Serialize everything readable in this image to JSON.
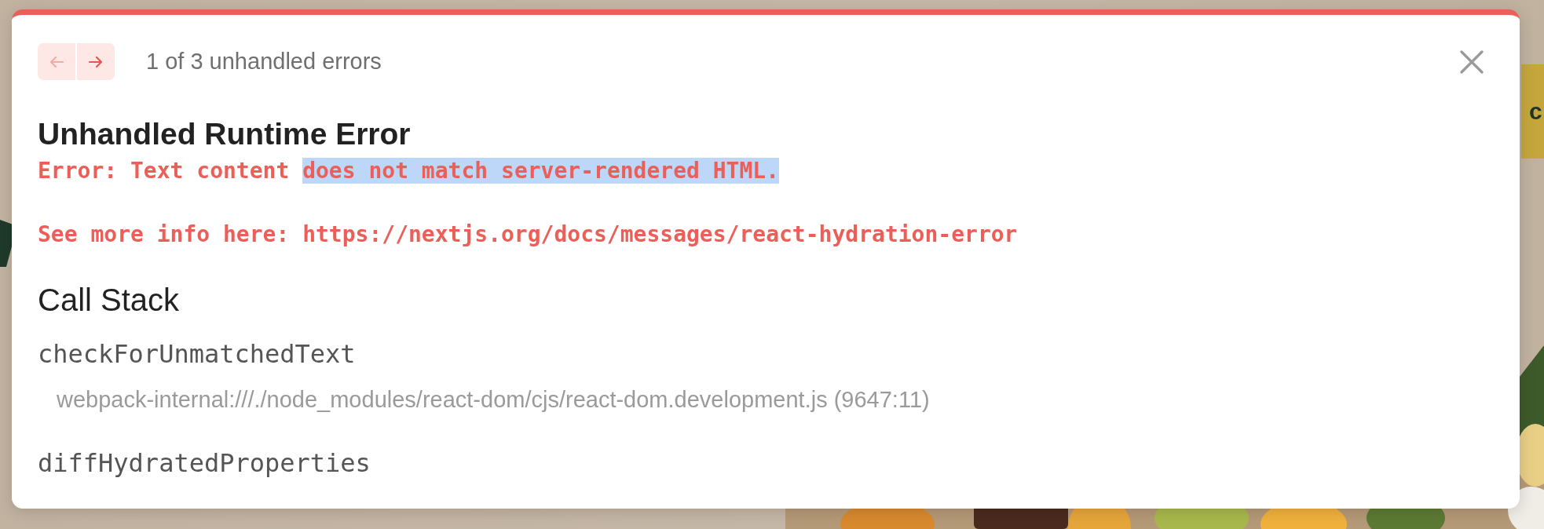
{
  "background": {
    "banner_text": "c",
    "kind": "picture"
  },
  "dialog": {
    "navigation": [
      {
        "kind": "previous",
        "disabled": true
      },
      {
        "kind": "next",
        "disabled": false
      }
    ],
    "counter": "1 of 3 unhandled errors",
    "title": "Unhandled Runtime Error",
    "error_message": {
      "text": "Error: Text content ",
      "selected_text": "does not match server-rendered HTML."
    },
    "info_line": "See more info here: https://nextjs.org/docs/messages/react-hydration-error",
    "call_stack": {
      "heading": "Call Stack",
      "frames": [
        {
          "function": "checkForUnmatchedText",
          "location": "webpack-internal:///./node_modules/react-dom/cjs/react-dom.development.js (9647:11)"
        },
        {
          "function": "diffHydratedProperties"
        }
      ]
    }
  }
}
